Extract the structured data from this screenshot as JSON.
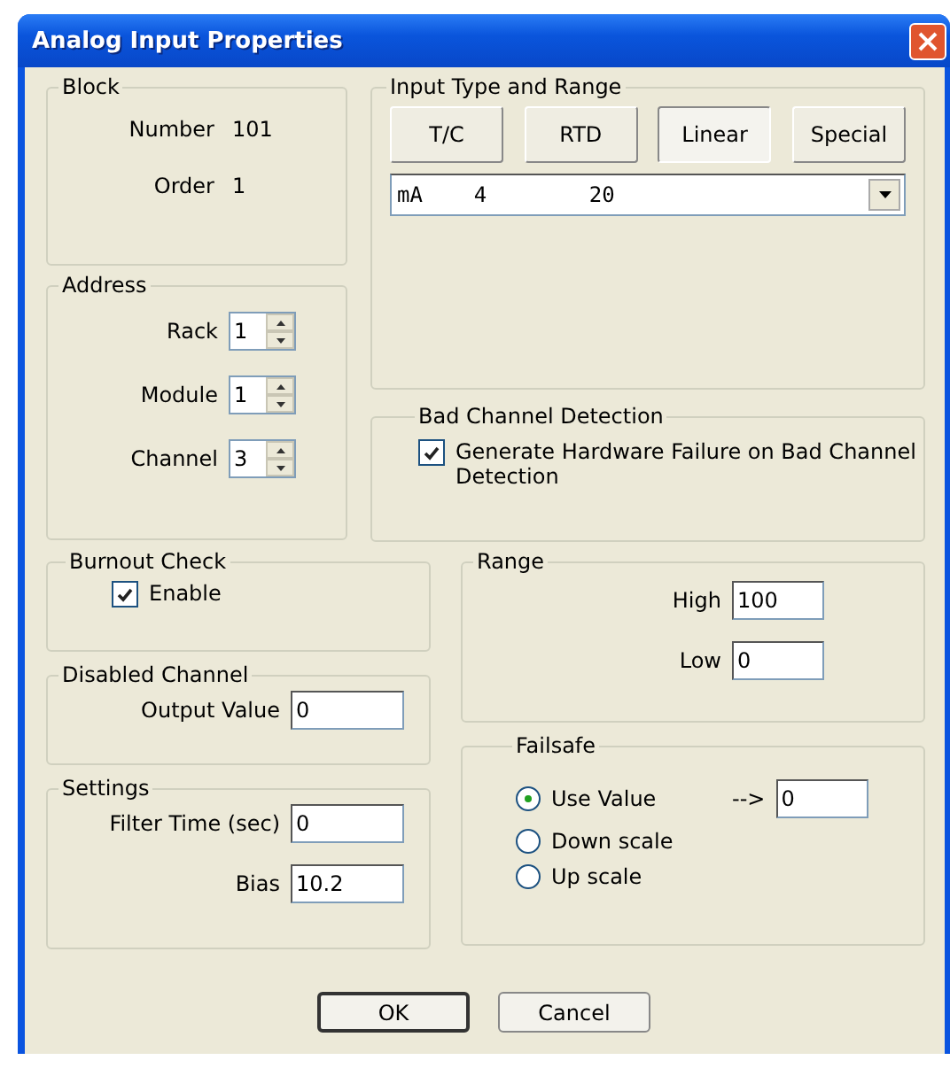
{
  "window": {
    "title": "Analog Input Properties"
  },
  "block": {
    "title": "Block",
    "fields": [
      {
        "label": "Number",
        "value": "101"
      },
      {
        "label": "Order",
        "value": "1"
      }
    ]
  },
  "address": {
    "title": "Address",
    "spinners": [
      {
        "label": "Rack",
        "value": "1"
      },
      {
        "label": "Module",
        "value": "1"
      },
      {
        "label": "Channel",
        "value": "3"
      }
    ]
  },
  "input_type": {
    "title": "Input Type and Range",
    "buttons": [
      {
        "label": "T/C",
        "selected": false
      },
      {
        "label": "RTD",
        "selected": false
      },
      {
        "label": "Linear",
        "selected": true
      },
      {
        "label": "Special",
        "selected": false
      }
    ],
    "dropdown": {
      "value": "mA    4        20"
    }
  },
  "bad_channel": {
    "title": "Bad Channel Detection",
    "checkbox": {
      "label": "Generate Hardware Failure on Bad Channel Detection",
      "checked": true
    }
  },
  "burnout": {
    "title": "Burnout Check",
    "checkbox": {
      "label": "Enable",
      "checked": true
    }
  },
  "disabled_channel": {
    "title": "Disabled Channel",
    "fields": [
      {
        "label": "Output Value",
        "value": "0"
      }
    ]
  },
  "settings": {
    "title": "Settings",
    "fields": [
      {
        "label": "Filter Time (sec)",
        "value": "0"
      },
      {
        "label": "Bias",
        "value": "10.2"
      }
    ]
  },
  "range": {
    "title": "Range",
    "fields": [
      {
        "label": "High",
        "value": "100"
      },
      {
        "label": "Low",
        "value": "0"
      }
    ]
  },
  "failsafe": {
    "title": "Failsafe",
    "options": [
      {
        "label": "Use Value",
        "selected": true
      },
      {
        "label": "Down scale",
        "selected": false
      },
      {
        "label": "Up scale",
        "selected": false
      }
    ],
    "arrow": "-->",
    "value": "0"
  },
  "buttons": [
    {
      "label": "OK",
      "default": true
    },
    {
      "label": "Cancel",
      "default": false
    }
  ]
}
